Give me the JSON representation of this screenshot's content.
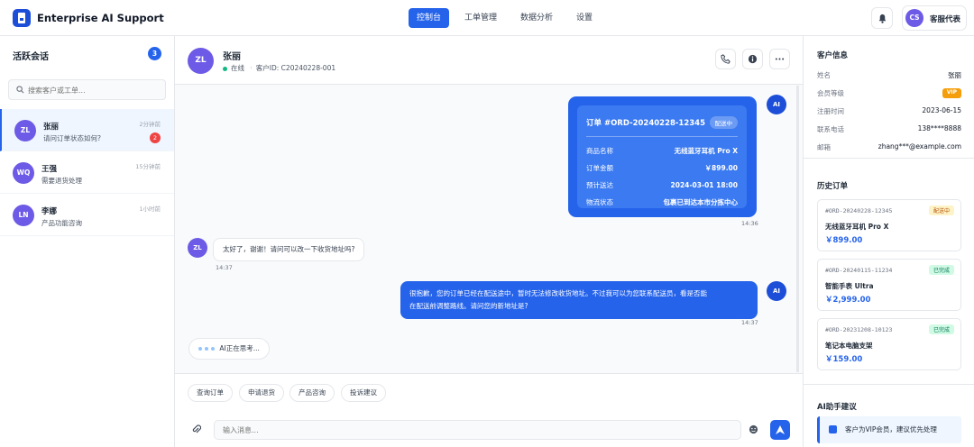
{
  "app": {
    "title": "Enterprise AI Support"
  },
  "nav": {
    "items": [
      "控制台",
      "工单管理",
      "数据分析",
      "设置"
    ],
    "active": 0
  },
  "user": {
    "initials": "CS",
    "name": "客服代表"
  },
  "sidebar": {
    "title": "活跃会话",
    "count": "3",
    "search_placeholder": "搜索客户或工单...",
    "conversations": [
      {
        "initials": "ZL",
        "name": "张丽",
        "preview": "请问订单状态如何?",
        "time": "2分钟前",
        "unread": "2"
      },
      {
        "initials": "WQ",
        "name": "王强",
        "preview": "需要退货处理",
        "time": "15分钟前",
        "unread": ""
      },
      {
        "initials": "LN",
        "name": "李娜",
        "preview": "产品功能咨询",
        "time": "1小时前",
        "unread": ""
      }
    ]
  },
  "chat": {
    "initials": "ZL",
    "name": "张丽",
    "status": "在线",
    "customer_id": "客户ID: C20240228-001",
    "order_card": {
      "title": "订单 #ORD-20240228-12345",
      "badge": "配送中",
      "rows": [
        {
          "k": "商品名称",
          "v": "无线蓝牙耳机 Pro X"
        },
        {
          "k": "订单金额",
          "v": "￥899.00"
        },
        {
          "k": "预计送达",
          "v": "2024-03-01 18:00"
        },
        {
          "k": "物流状态",
          "v": "包裹已到达本市分拣中心"
        }
      ],
      "time": "14:36"
    },
    "ai_label": "AI",
    "user_msg": {
      "text": "太好了，谢谢！请问可以改一下收货地址吗?",
      "time": "14:37"
    },
    "ai_msg": {
      "line1": "很抱歉，您的订单已经在配送途中，暂时无法修改收货地址。不过我可以为您联系配送员，看是否能",
      "line2": "在配送前调整路线。请问您的新地址是?",
      "time": "14:37"
    },
    "typing": "AI正在思考..."
  },
  "quick_actions": [
    "查询订单",
    "申请退货",
    "产品咨询",
    "投诉建议"
  ],
  "composer": {
    "placeholder": "输入消息..."
  },
  "customer": {
    "title": "客户信息",
    "fields": [
      {
        "k": "姓名",
        "v": "张丽"
      },
      {
        "k": "会员等级",
        "v": "VIP"
      },
      {
        "k": "注册时间",
        "v": "2023-06-15"
      },
      {
        "k": "联系电话",
        "v": "138****8888"
      },
      {
        "k": "邮箱",
        "v": "zhang***@example.com"
      }
    ]
  },
  "history": {
    "title": "历史订单",
    "orders": [
      {
        "id": "#ORD-20240228-12345",
        "status": "配送中",
        "name": "无线蓝牙耳机 Pro X",
        "price": "￥899.00"
      },
      {
        "id": "#ORD-20240115-11234",
        "status": "已完成",
        "name": "智能手表 Ultra",
        "price": "￥2,999.00"
      },
      {
        "id": "#ORD-20231208-10123",
        "status": "已完成",
        "name": "笔记本电脑支架",
        "price": "￥159.00"
      }
    ]
  },
  "ai_suggest": {
    "title": "AI助手建议",
    "item": "客户为VIP会员，建议优先处理"
  }
}
